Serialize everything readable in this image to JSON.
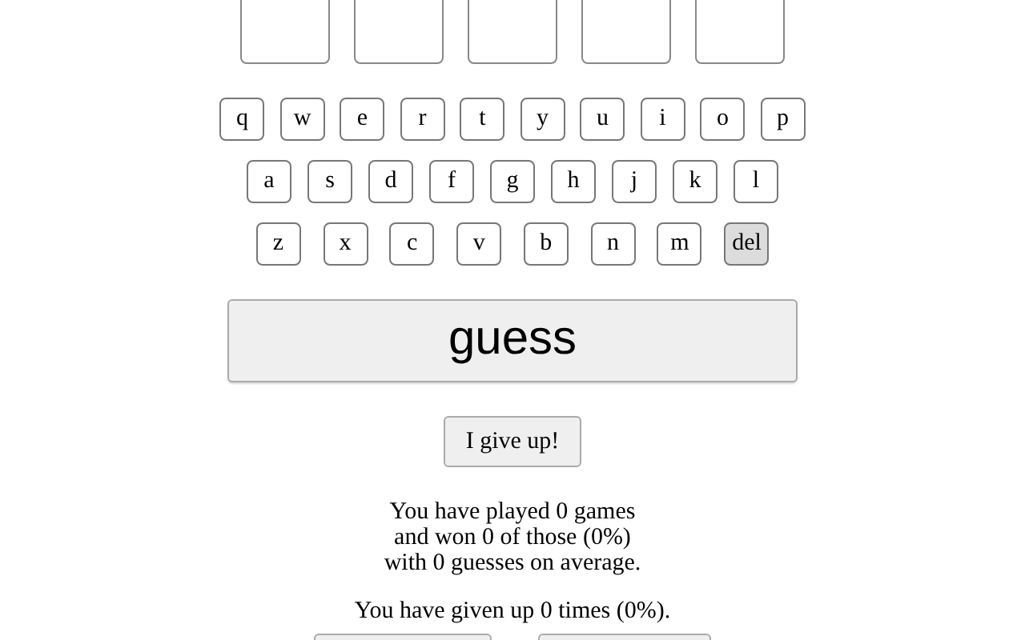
{
  "tiles": [
    {
      "filled": false
    },
    {
      "filled": false
    },
    {
      "filled": false
    },
    {
      "filled": false
    },
    {
      "filled": false
    }
  ],
  "keyboard": [
    [
      {
        "label": "q",
        "highlighted": false
      },
      {
        "label": "w",
        "highlighted": false
      },
      {
        "label": "e",
        "highlighted": false
      },
      {
        "label": "r",
        "highlighted": false
      },
      {
        "label": "t",
        "highlighted": false
      },
      {
        "label": "y",
        "highlighted": false
      },
      {
        "label": "u",
        "highlighted": false
      },
      {
        "label": "i",
        "highlighted": false
      },
      {
        "label": "o",
        "highlighted": false
      },
      {
        "label": "p",
        "highlighted": false
      }
    ],
    [
      {
        "label": "a",
        "highlighted": false
      },
      {
        "label": "s",
        "highlighted": false
      },
      {
        "label": "d",
        "highlighted": false
      },
      {
        "label": "f",
        "highlighted": false
      },
      {
        "label": "g",
        "highlighted": false
      },
      {
        "label": "h",
        "highlighted": false
      },
      {
        "label": "j",
        "highlighted": false
      },
      {
        "label": "k",
        "highlighted": false
      },
      {
        "label": "l",
        "highlighted": false
      }
    ],
    [
      {
        "label": "z",
        "highlighted": false
      },
      {
        "label": "x",
        "highlighted": false
      },
      {
        "label": "c",
        "highlighted": false
      },
      {
        "label": "v",
        "highlighted": false
      },
      {
        "label": "b",
        "highlighted": false
      },
      {
        "label": "n",
        "highlighted": false
      },
      {
        "label": "m",
        "highlighted": false
      },
      {
        "label": "del",
        "highlighted": true
      }
    ]
  ],
  "guess_button": "guess",
  "give_up_button": "I give up!",
  "stats": [
    "You have played 0 games",
    "and won 0 of those (0%)",
    "with 0 guesses on average."
  ],
  "given_up": "You have given up 0 times (0%)."
}
